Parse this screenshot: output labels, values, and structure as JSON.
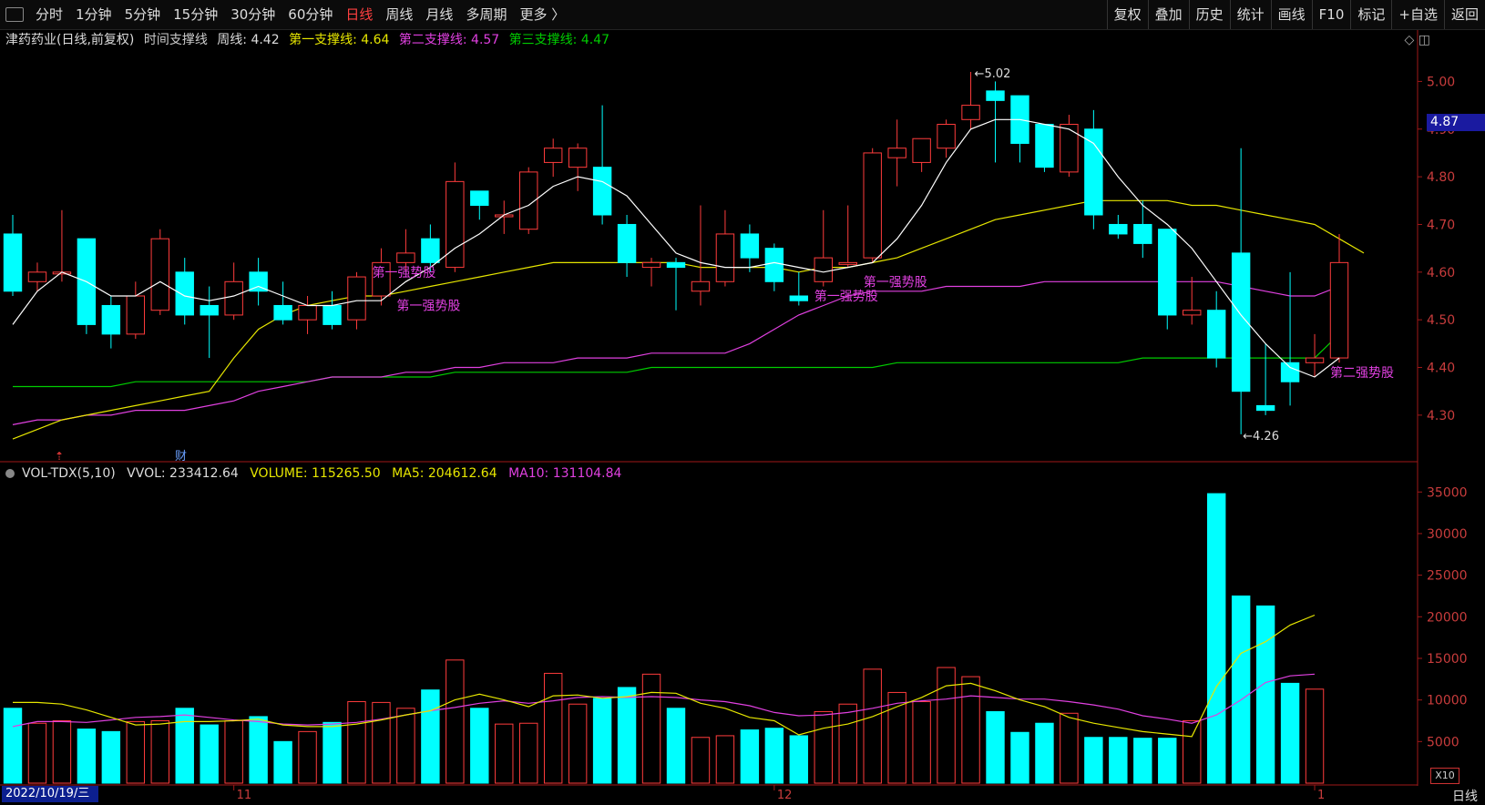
{
  "toolbar": {
    "periods": [
      "分时",
      "1分钟",
      "5分钟",
      "15分钟",
      "30分钟",
      "60分钟",
      "日线",
      "周线",
      "月线",
      "多周期",
      "更多 〉"
    ],
    "active_period": "日线",
    "right_items": [
      "复权",
      "叠加",
      "历史",
      "统计",
      "画线",
      "F10",
      "标记",
      "+自选",
      "返回"
    ]
  },
  "info": {
    "stock": "津药药业(日线,前复权)",
    "indicator": "时间支撑线",
    "weekly": "周线: 4.42",
    "s1": "第一支撑线: 4.64",
    "s2": "第二支撑线: 4.57",
    "s3": "第三支撑线: 4.47"
  },
  "vol_info": {
    "name": "VOL-TDX(5,10)",
    "vvol": "VVOL: 233412.64",
    "volume": "VOLUME: 115265.50",
    "ma5": "MA5: 204612.64",
    "ma10": "MA10: 131104.84"
  },
  "current_price": "4.87",
  "date_label": "2022/10/19/三",
  "period_tag": "日线",
  "x10_label": "X10",
  "colors": {
    "up": "#ff3c3c",
    "down": "#00ffff",
    "ma_white": "#ffffff",
    "ma_yellow": "#e6e600",
    "ma_magenta": "#e040e0",
    "ma_green": "#00cc00"
  },
  "chart_data": [
    {
      "type": "candlestick",
      "price_axis_ticks": [
        5.0,
        4.9,
        4.8,
        4.7,
        4.6,
        4.5,
        4.4,
        4.3
      ],
      "ylim": [
        4.21,
        5.06
      ],
      "x_labels": [
        "11",
        "12",
        "1"
      ],
      "x_label_positions": [
        9,
        31,
        53
      ],
      "candles": [
        {
          "o": 4.68,
          "h": 4.72,
          "l": 4.55,
          "c": 4.56
        },
        {
          "o": 4.58,
          "h": 4.62,
          "l": 4.56,
          "c": 4.6
        },
        {
          "o": 4.6,
          "h": 4.73,
          "l": 4.58,
          "c": 4.6
        },
        {
          "o": 4.67,
          "h": 4.67,
          "l": 4.47,
          "c": 4.49
        },
        {
          "o": 4.53,
          "h": 4.55,
          "l": 4.44,
          "c": 4.47
        },
        {
          "o": 4.47,
          "h": 4.58,
          "l": 4.46,
          "c": 4.55
        },
        {
          "o": 4.52,
          "h": 4.69,
          "l": 4.51,
          "c": 4.67
        },
        {
          "o": 4.6,
          "h": 4.63,
          "l": 4.49,
          "c": 4.51
        },
        {
          "o": 4.53,
          "h": 4.57,
          "l": 4.42,
          "c": 4.51
        },
        {
          "o": 4.51,
          "h": 4.62,
          "l": 4.5,
          "c": 4.58
        },
        {
          "o": 4.6,
          "h": 4.63,
          "l": 4.53,
          "c": 4.56
        },
        {
          "o": 4.53,
          "h": 4.58,
          "l": 4.49,
          "c": 4.5
        },
        {
          "o": 4.5,
          "h": 4.55,
          "l": 4.47,
          "c": 4.53
        },
        {
          "o": 4.53,
          "h": 4.56,
          "l": 4.48,
          "c": 4.49
        },
        {
          "o": 4.5,
          "h": 4.6,
          "l": 4.48,
          "c": 4.59
        },
        {
          "o": 4.55,
          "h": 4.65,
          "l": 4.53,
          "c": 4.62
        },
        {
          "o": 4.62,
          "h": 4.69,
          "l": 4.6,
          "c": 4.64
        },
        {
          "o": 4.67,
          "h": 4.7,
          "l": 4.6,
          "c": 4.62
        },
        {
          "o": 4.61,
          "h": 4.83,
          "l": 4.6,
          "c": 4.79
        },
        {
          "o": 4.77,
          "h": 4.77,
          "l": 4.71,
          "c": 4.74
        },
        {
          "o": 4.72,
          "h": 4.75,
          "l": 4.68,
          "c": 4.72
        },
        {
          "o": 4.69,
          "h": 4.82,
          "l": 4.68,
          "c": 4.81
        },
        {
          "o": 4.83,
          "h": 4.88,
          "l": 4.8,
          "c": 4.86
        },
        {
          "o": 4.82,
          "h": 4.87,
          "l": 4.77,
          "c": 4.86
        },
        {
          "o": 4.82,
          "h": 4.95,
          "l": 4.7,
          "c": 4.72
        },
        {
          "o": 4.7,
          "h": 4.72,
          "l": 4.59,
          "c": 4.62
        },
        {
          "o": 4.61,
          "h": 4.63,
          "l": 4.57,
          "c": 4.62
        },
        {
          "o": 4.62,
          "h": 4.63,
          "l": 4.52,
          "c": 4.61
        },
        {
          "o": 4.56,
          "h": 4.74,
          "l": 4.53,
          "c": 4.58
        },
        {
          "o": 4.58,
          "h": 4.73,
          "l": 4.57,
          "c": 4.68
        },
        {
          "o": 4.68,
          "h": 4.7,
          "l": 4.6,
          "c": 4.63
        },
        {
          "o": 4.65,
          "h": 4.66,
          "l": 4.56,
          "c": 4.58
        },
        {
          "o": 4.55,
          "h": 4.6,
          "l": 4.53,
          "c": 4.54
        },
        {
          "o": 4.58,
          "h": 4.73,
          "l": 4.57,
          "c": 4.63
        },
        {
          "o": 4.62,
          "h": 4.74,
          "l": 4.61,
          "c": 4.62
        },
        {
          "o": 4.63,
          "h": 4.86,
          "l": 4.62,
          "c": 4.85
        },
        {
          "o": 4.84,
          "h": 4.92,
          "l": 4.78,
          "c": 4.86
        },
        {
          "o": 4.83,
          "h": 4.88,
          "l": 4.81,
          "c": 4.88
        },
        {
          "o": 4.86,
          "h": 4.92,
          "l": 4.84,
          "c": 4.91
        },
        {
          "o": 4.92,
          "h": 5.02,
          "l": 4.9,
          "c": 4.95
        },
        {
          "o": 4.98,
          "h": 5.0,
          "l": 4.83,
          "c": 4.96
        },
        {
          "o": 4.97,
          "h": 4.97,
          "l": 4.83,
          "c": 4.87
        },
        {
          "o": 4.91,
          "h": 4.91,
          "l": 4.81,
          "c": 4.82
        },
        {
          "o": 4.81,
          "h": 4.93,
          "l": 4.8,
          "c": 4.91
        },
        {
          "o": 4.9,
          "h": 4.94,
          "l": 4.69,
          "c": 4.72
        },
        {
          "o": 4.7,
          "h": 4.72,
          "l": 4.67,
          "c": 4.68
        },
        {
          "o": 4.7,
          "h": 4.75,
          "l": 4.63,
          "c": 4.66
        },
        {
          "o": 4.69,
          "h": 4.69,
          "l": 4.48,
          "c": 4.51
        },
        {
          "o": 4.51,
          "h": 4.59,
          "l": 4.49,
          "c": 4.52
        },
        {
          "o": 4.52,
          "h": 4.56,
          "l": 4.4,
          "c": 4.42
        },
        {
          "o": 4.64,
          "h": 4.86,
          "l": 4.26,
          "c": 4.35
        },
        {
          "o": 4.32,
          "h": 4.45,
          "l": 4.3,
          "c": 4.31
        },
        {
          "o": 4.41,
          "h": 4.6,
          "l": 4.32,
          "c": 4.37
        },
        {
          "o": 4.41,
          "h": 4.47,
          "l": 4.38,
          "c": 4.42
        },
        {
          "o": 4.42,
          "h": 4.68,
          "l": 4.41,
          "c": 4.62
        }
      ],
      "ma_white": [
        4.49,
        4.56,
        4.6,
        4.58,
        4.55,
        4.55,
        4.58,
        4.55,
        4.54,
        4.55,
        4.57,
        4.55,
        4.53,
        4.53,
        4.54,
        4.54,
        4.58,
        4.61,
        4.65,
        4.68,
        4.72,
        4.74,
        4.78,
        4.8,
        4.79,
        4.76,
        4.7,
        4.64,
        4.62,
        4.61,
        4.61,
        4.62,
        4.61,
        4.6,
        4.61,
        4.62,
        4.67,
        4.74,
        4.83,
        4.9,
        4.92,
        4.92,
        4.91,
        4.9,
        4.87,
        4.8,
        4.74,
        4.7,
        4.65,
        4.58,
        4.51,
        4.45,
        4.4,
        4.38,
        4.42
      ],
      "ma_yellow": [
        4.25,
        4.27,
        4.29,
        4.3,
        4.31,
        4.32,
        4.33,
        4.34,
        4.35,
        4.42,
        4.48,
        4.51,
        4.53,
        4.54,
        4.55,
        4.55,
        4.56,
        4.57,
        4.58,
        4.59,
        4.6,
        4.61,
        4.62,
        4.62,
        4.62,
        4.62,
        4.62,
        4.62,
        4.61,
        4.61,
        4.61,
        4.61,
        4.6,
        4.61,
        4.61,
        4.62,
        4.63,
        4.65,
        4.67,
        4.69,
        4.71,
        4.72,
        4.73,
        4.74,
        4.75,
        4.75,
        4.75,
        4.75,
        4.74,
        4.74,
        4.73,
        4.72,
        4.71,
        4.7,
        4.67,
        4.64
      ],
      "ma_magenta": [
        4.28,
        4.29,
        4.29,
        4.3,
        4.3,
        4.31,
        4.31,
        4.31,
        4.32,
        4.33,
        4.35,
        4.36,
        4.37,
        4.38,
        4.38,
        4.38,
        4.39,
        4.39,
        4.4,
        4.4,
        4.41,
        4.41,
        4.41,
        4.42,
        4.42,
        4.42,
        4.43,
        4.43,
        4.43,
        4.43,
        4.45,
        4.48,
        4.51,
        4.53,
        4.55,
        4.56,
        4.56,
        4.56,
        4.57,
        4.57,
        4.57,
        4.57,
        4.58,
        4.58,
        4.58,
        4.58,
        4.58,
        4.58,
        4.58,
        4.58,
        4.57,
        4.56,
        4.55,
        4.55,
        4.57
      ],
      "ma_green": [
        4.36,
        4.36,
        4.36,
        4.36,
        4.36,
        4.37,
        4.37,
        4.37,
        4.37,
        4.37,
        4.37,
        4.37,
        4.37,
        4.38,
        4.38,
        4.38,
        4.38,
        4.38,
        4.39,
        4.39,
        4.39,
        4.39,
        4.39,
        4.39,
        4.39,
        4.39,
        4.4,
        4.4,
        4.4,
        4.4,
        4.4,
        4.4,
        4.4,
        4.4,
        4.4,
        4.4,
        4.41,
        4.41,
        4.41,
        4.41,
        4.41,
        4.41,
        4.41,
        4.41,
        4.41,
        4.41,
        4.42,
        4.42,
        4.42,
        4.42,
        4.42,
        4.42,
        4.42,
        4.42,
        4.47
      ],
      "annotations": [
        {
          "text": "第一强势股",
          "i": 15,
          "price": 4.6
        },
        {
          "text": "第一强势股",
          "i": 16,
          "price": 4.53
        },
        {
          "text": "第一强势股",
          "i": 33,
          "price": 4.55
        },
        {
          "text": "第一强势股",
          "i": 35,
          "price": 4.58
        },
        {
          "text": "第二强势股",
          "i": 54,
          "price": 4.39
        }
      ],
      "max_label": "5.02",
      "min_label": "4.26"
    },
    {
      "type": "bar",
      "name": "volume",
      "axis_ticks": [
        35000,
        30000,
        25000,
        20000,
        15000,
        10000,
        5000
      ],
      "ylim": [
        0,
        37000
      ],
      "values": [
        9000,
        7200,
        7500,
        6500,
        6200,
        7400,
        7500,
        9000,
        7000,
        7500,
        8000,
        5000,
        6200,
        7300,
        9800,
        9700,
        9000,
        11200,
        14800,
        9000,
        7100,
        7200,
        13200,
        9500,
        10200,
        11500,
        13100,
        9000,
        5500,
        5700,
        6400,
        6600,
        5700,
        8600,
        9500,
        13700,
        10900,
        9800,
        13900,
        12800,
        8600,
        6100,
        7200,
        8400,
        5500,
        5500,
        5400,
        5400,
        7500,
        34800,
        22500,
        21300,
        12000,
        11300
      ],
      "ma5": [
        9700,
        9700,
        9500,
        8800,
        7900,
        7000,
        7100,
        7400,
        7400,
        7500,
        7700,
        7000,
        6800,
        6800,
        7100,
        7600,
        8200,
        8700,
        10000,
        10700,
        10000,
        9200,
        10500,
        10600,
        10200,
        10400,
        10900,
        10800,
        9600,
        9000,
        7900,
        7500,
        5800,
        6600,
        7100,
        8000,
        9200,
        10300,
        11700,
        12000,
        11100,
        10000,
        9200,
        7900,
        7200,
        6700,
        6200,
        5900,
        5600,
        11600,
        15600,
        17000,
        19000,
        20200
      ],
      "ma10": [
        6800,
        7400,
        7400,
        7300,
        7600,
        7900,
        8000,
        8200,
        7900,
        7600,
        7400,
        7100,
        7000,
        7100,
        7300,
        7700,
        8200,
        8700,
        9100,
        9600,
        9900,
        9600,
        9900,
        10300,
        10400,
        10300,
        10400,
        10300,
        10000,
        9800,
        9300,
        8500,
        8100,
        8200,
        8500,
        9000,
        9600,
        9900,
        10100,
        10500,
        10300,
        10100,
        10100,
        9800,
        9400,
        8900,
        8100,
        7700,
        7200,
        8200,
        10000,
        12100,
        12900,
        13100
      ]
    }
  ]
}
